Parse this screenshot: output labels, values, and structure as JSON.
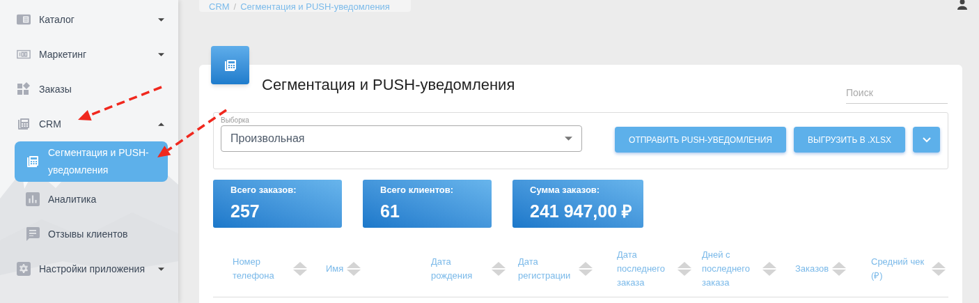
{
  "breadcrumb": {
    "separator": "/",
    "items": [
      "CRM",
      "Сегментация и PUSH-уведомления"
    ]
  },
  "sidebar": {
    "items": [
      {
        "label": "Каталог",
        "kind": "catalog",
        "expanded": false,
        "selected": false
      },
      {
        "label": "Маркетинг",
        "kind": "marketing",
        "expanded": false,
        "selected": false
      },
      {
        "label": "Заказы",
        "kind": "orders",
        "selected": false
      },
      {
        "label": "CRM",
        "kind": "crm",
        "expanded": true,
        "selected": false,
        "children": [
          {
            "label": "Сегментация и PUSH-уведомления",
            "kind": "crm",
            "selected": true
          },
          {
            "label": "Аналитика",
            "kind": "chart",
            "selected": false
          },
          {
            "label": "Отзывы клиентов",
            "kind": "comment",
            "selected": false
          }
        ]
      },
      {
        "label": "Настройки приложения",
        "kind": "settings",
        "expanded": false,
        "selected": false
      }
    ]
  },
  "page": {
    "title": "Сегментация и PUSH-уведомления",
    "search": {
      "placeholder": "Поиск"
    },
    "selection": {
      "label": "Выборка",
      "value": "Произвольная"
    },
    "buttons": [
      {
        "label": "ОТПРАВИТЬ PUSH-УВЕДОМЛЕНИЯ",
        "kind": "text"
      },
      {
        "label": "ВЫГРУЗИТЬ В .XLSX",
        "kind": "text"
      },
      {
        "kind": "menu"
      }
    ],
    "stats": [
      {
        "label": "Всего заказов:",
        "value": "257"
      },
      {
        "label": "Всего клиентов:",
        "value": "61"
      },
      {
        "label": "Сумма заказов:",
        "value": "241 947,00 ₽"
      }
    ],
    "table": {
      "columns": [
        "Номер телефона",
        "Имя",
        "Дата рождения",
        "Дата регистрации",
        "Дата последнего заказа",
        "Дней с последнего заказа",
        "Заказов",
        "Средний чек (₽)"
      ]
    }
  },
  "annotations": [
    {
      "kind": "arrow"
    },
    {
      "kind": "arrow"
    }
  ]
}
